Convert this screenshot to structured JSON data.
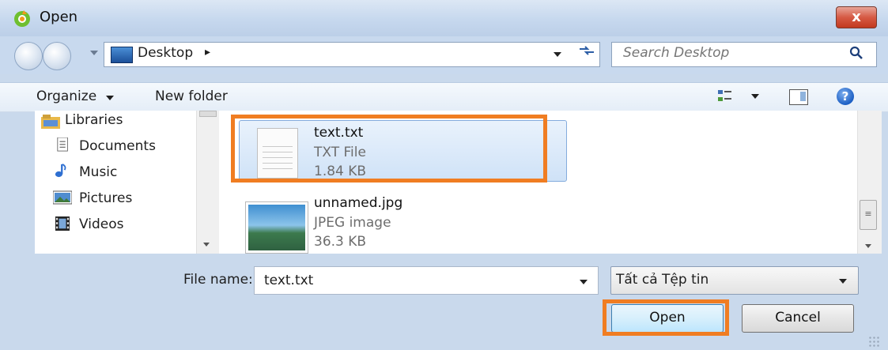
{
  "window": {
    "title": "Open",
    "close_glyph": "x"
  },
  "address": {
    "location": "Desktop",
    "crumb_arrow": "▸"
  },
  "search": {
    "placeholder": "Search Desktop"
  },
  "toolbar": {
    "organize_label": "Organize",
    "new_folder_label": "New folder",
    "help_glyph": "?"
  },
  "nav": {
    "items": [
      {
        "label": "Libraries",
        "icon": "libraries-icon"
      },
      {
        "label": "Documents",
        "icon": "documents-icon"
      },
      {
        "label": "Music",
        "icon": "music-icon"
      },
      {
        "label": "Pictures",
        "icon": "pictures-icon"
      },
      {
        "label": "Videos",
        "icon": "videos-icon"
      }
    ]
  },
  "files": [
    {
      "name": "text.txt",
      "type": "TXT File",
      "size": "1.84 KB",
      "selected": true
    },
    {
      "name": "unnamed.jpg",
      "type": "JPEG image",
      "size": "36.3 KB",
      "selected": false
    }
  ],
  "bottom": {
    "filename_label": "File name:",
    "filename_value": "text.txt",
    "filter_value": "Tất cả Tệp tin",
    "open_label": "Open",
    "cancel_label": "Cancel"
  },
  "colors": {
    "highlight": "#f07d22",
    "selection": "#cfe2f7",
    "titlebar": "#c6d8ee"
  }
}
